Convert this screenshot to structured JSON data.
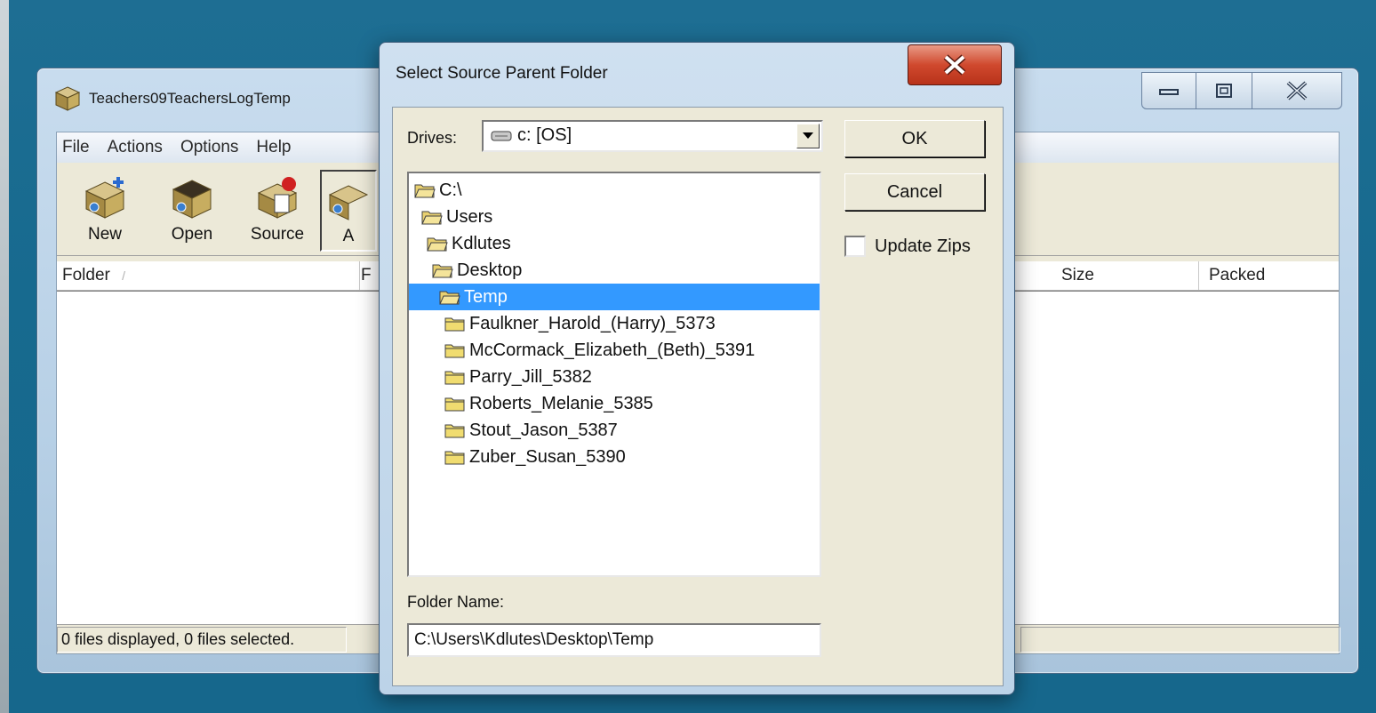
{
  "main_window": {
    "title": "Teachers09TeachersLogTemp",
    "menu": [
      "File",
      "Actions",
      "Options",
      "Help"
    ],
    "toolbar": [
      {
        "label": "New",
        "icon": "new-package-icon"
      },
      {
        "label": "Open",
        "icon": "open-package-icon"
      },
      {
        "label": "Source",
        "icon": "source-package-icon"
      },
      {
        "label": "A",
        "icon": "add-package-icon"
      }
    ],
    "columns": {
      "folder": "Folder",
      "f": "F",
      "size": "Size",
      "packed": "Packed"
    },
    "status": "0 files displayed, 0 files selected."
  },
  "dialog": {
    "title": "Select Source Parent Folder",
    "drives_label": "Drives:",
    "drive_value": "c: [OS]",
    "tree": [
      {
        "name": "C:\\",
        "level": 0,
        "icon": "open-folder"
      },
      {
        "name": "Users",
        "level": 1,
        "icon": "open-folder"
      },
      {
        "name": "Kdlutes",
        "level": 2,
        "icon": "open-folder"
      },
      {
        "name": "Desktop",
        "level": 3,
        "icon": "open-folder"
      },
      {
        "name": "Temp",
        "level": 4,
        "icon": "open-folder",
        "selected": true
      },
      {
        "name": "Faulkner_Harold_(Harry)_5373",
        "level": 5,
        "icon": "closed-folder"
      },
      {
        "name": "McCormack_Elizabeth_(Beth)_5391",
        "level": 5,
        "icon": "closed-folder"
      },
      {
        "name": "Parry_Jill_5382",
        "level": 5,
        "icon": "closed-folder"
      },
      {
        "name": "Roberts_Melanie_5385",
        "level": 5,
        "icon": "closed-folder"
      },
      {
        "name": "Stout_Jason_5387",
        "level": 5,
        "icon": "closed-folder"
      },
      {
        "name": "Zuber_Susan_5390",
        "level": 5,
        "icon": "closed-folder"
      }
    ],
    "ok_label": "OK",
    "cancel_label": "Cancel",
    "update_zips_label": "Update Zips",
    "update_zips_checked": false,
    "folder_name_label": "Folder Name:",
    "folder_name_value": "C:\\Users\\Kdlutes\\Desktop\\Temp"
  },
  "colors": {
    "desktop": "#176a8f",
    "selection": "#3399ff",
    "close_button": "#d0492e"
  }
}
